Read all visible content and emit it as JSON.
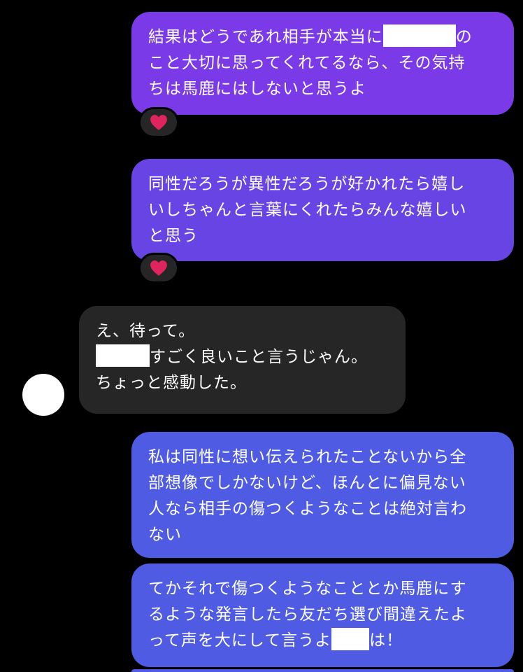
{
  "colors": {
    "background": "#000000",
    "sent_purple": "#7B3AE8",
    "sent_violet": "#6744E3",
    "sent_blue": "#4E5BE2",
    "received_gray": "#262626",
    "reaction_bg": "#262626",
    "heart": "#E0245E"
  },
  "messages": [
    {
      "direction": "sent",
      "lines": [
        {
          "before": "結果はどうであれ相手が本当に",
          "after": "の"
        },
        "こと大切に思ってくれてるなら、その気持",
        "ちは馬鹿にはしないと思うよ"
      ],
      "reaction": "heart-icon"
    },
    {
      "direction": "sent",
      "lines": [
        "同性だろうが異性だろうが好かれたら嬉し",
        "いしちゃんと言葉にくれたらみんな嬉しい",
        "と思う"
      ],
      "reaction": "heart-icon"
    },
    {
      "direction": "received",
      "lines": [
        "え、待って。",
        {
          "before": "",
          "after": "すごく良いこと言うじゃん。"
        },
        "ちょっと感動した。"
      ]
    },
    {
      "direction": "sent",
      "lines": [
        "私は同性に想い伝えられたことないから全",
        "部想像でしかないけど、ほんとに偏見ない",
        "人なら相手の傷つくようなことは絶対言わ",
        "ない"
      ]
    },
    {
      "direction": "sent",
      "lines": [
        "てかそれで傷つくようなこととか馬鹿にす",
        "るような発言したら友だち選び間違えたよ",
        {
          "before": "って声を大にして言うよ",
          "after": "は！"
        }
      ]
    }
  ]
}
